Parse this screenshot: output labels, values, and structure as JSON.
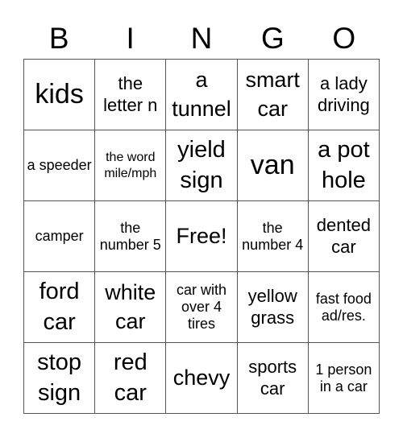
{
  "title_letters": [
    "B",
    "I",
    "N",
    "G",
    "O"
  ],
  "cells": [
    [
      "kids",
      "the letter n",
      "a tunnel",
      "smart car",
      "a lady driving"
    ],
    [
      "a speeder",
      "the word mile/mph",
      "yield sign",
      "van",
      "a pot hole"
    ],
    [
      "camper",
      "the number 5",
      "Free!",
      "the number 4",
      "dented car"
    ],
    [
      "ford car",
      "white car",
      "car with over 4 tires",
      "yellow grass",
      "fast food ad/res."
    ],
    [
      "stop sign",
      "red car",
      "chevy",
      "sports car",
      "1 person in a car"
    ]
  ]
}
